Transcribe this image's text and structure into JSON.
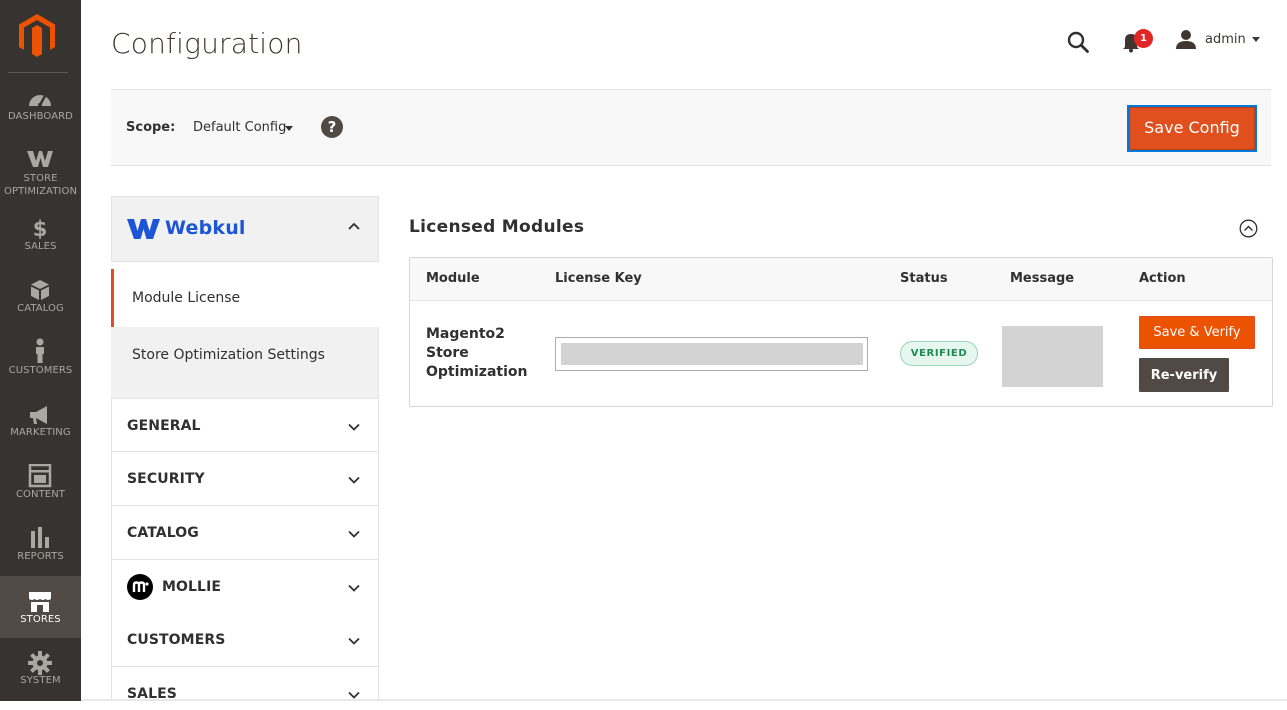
{
  "menu": {
    "items": [
      {
        "label": "DASHBOARD",
        "icon": "dashboard-icon"
      },
      {
        "label": "STORE OPTIMIZATION",
        "icon": "webkul-w-icon"
      },
      {
        "label": "SALES",
        "icon": "dollar-icon"
      },
      {
        "label": "CATALOG",
        "icon": "box-icon"
      },
      {
        "label": "CUSTOMERS",
        "icon": "person-icon"
      },
      {
        "label": "MARKETING",
        "icon": "megaphone-icon"
      },
      {
        "label": "CONTENT",
        "icon": "layout-icon"
      },
      {
        "label": "REPORTS",
        "icon": "bar-chart-icon"
      },
      {
        "label": "STORES",
        "icon": "storefront-icon",
        "active": true
      },
      {
        "label": "SYSTEM",
        "icon": "gear-icon"
      }
    ],
    "store_opt_line1": "STORE",
    "store_opt_line2": "OPTIMIZATION",
    "bg_color": "#373330",
    "logo_color": "#eb5202"
  },
  "header": {
    "title": "Configuration",
    "notification_count": "1",
    "user_name": "admin"
  },
  "scope": {
    "label": "Scope:",
    "value": "Default Config",
    "help": "?",
    "save_label": "Save Config"
  },
  "tabs": {
    "vendor": "Webkul",
    "sub_items": [
      "Module License",
      "Store Optimization Settings"
    ],
    "sections": [
      "GENERAL",
      "SECURITY",
      "CATALOG",
      "MOLLIE",
      "CUSTOMERS",
      "SALES"
    ]
  },
  "main": {
    "section_title": "Licensed Modules",
    "columns": [
      "Module",
      "License Key",
      "Status",
      "Message",
      "Action"
    ],
    "row": {
      "module_line1": "Magento2",
      "module_line2": "Store",
      "module_line3": "Optimization",
      "status": "VERIFIED",
      "save_verify_label": "Save & Verify",
      "reverify_label": "Re-verify"
    }
  },
  "colors": {
    "accent": "#eb5202",
    "save_button": "#e04f1e",
    "dark_button": "#514943",
    "verified_text": "#1f8a53",
    "webkul_blue": "#1c55d6"
  }
}
